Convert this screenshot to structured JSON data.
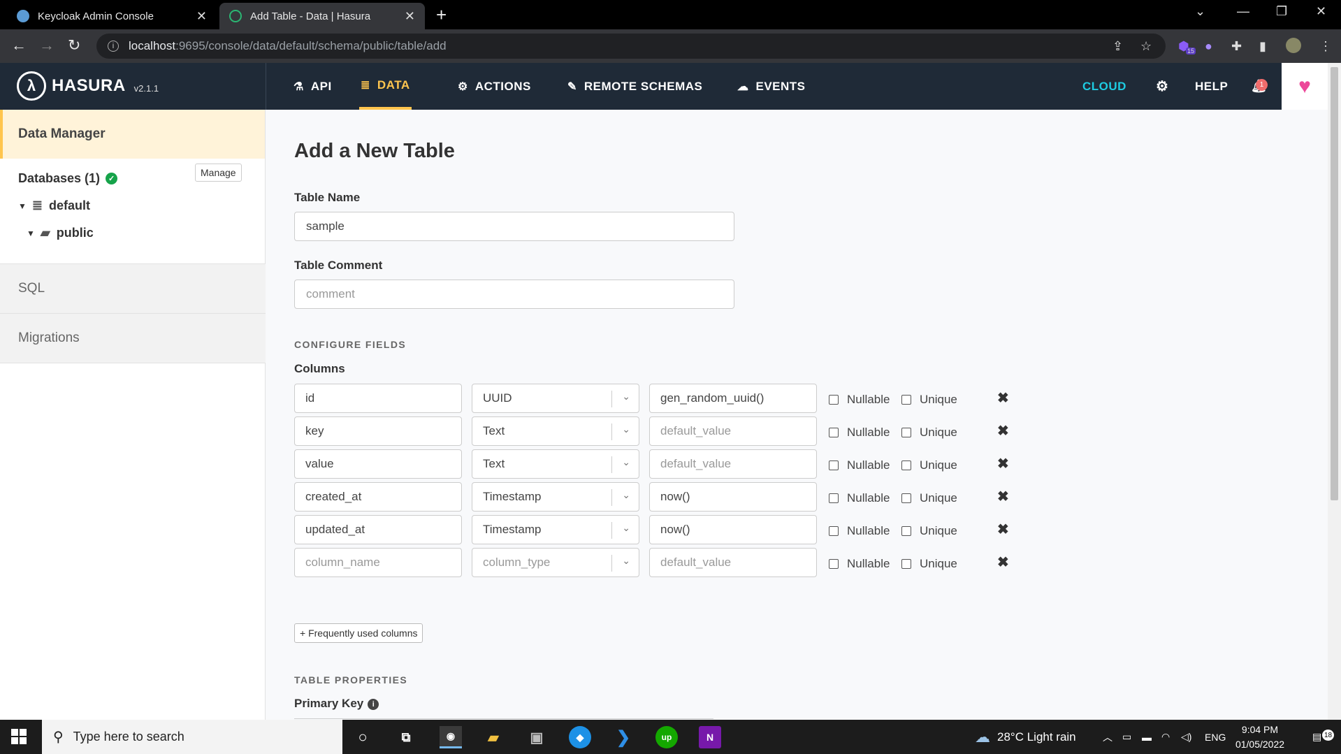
{
  "browser": {
    "tabs": [
      {
        "title": "Keycloak Admin Console",
        "active": false
      },
      {
        "title": "Add Table - Data | Hasura",
        "active": true
      }
    ],
    "url_host": "localhost",
    "url_rest": ":9695/console/data/default/schema/public/table/add",
    "extension_badge": "15"
  },
  "header": {
    "logo_text": "HASURA",
    "version": "v2.1.1",
    "nav": [
      {
        "label": "API",
        "icon": "flask-icon",
        "active": false
      },
      {
        "label": "DATA",
        "icon": "database-icon",
        "active": true
      },
      {
        "label": "ACTIONS",
        "icon": "gears-icon",
        "active": false
      },
      {
        "label": "REMOTE SCHEMAS",
        "icon": "plug-icon",
        "active": false
      },
      {
        "label": "EVENTS",
        "icon": "cloud-icon",
        "active": false
      }
    ],
    "cloud_label": "CLOUD",
    "help_label": "HELP",
    "notification_count": "1"
  },
  "sidebar": {
    "title": "Data Manager",
    "databases_label": "Databases (1)",
    "manage_label": "Manage",
    "tree": [
      {
        "label": "default",
        "icon": "database-icon"
      },
      {
        "label": "public",
        "icon": "folder-open-icon"
      }
    ],
    "items": [
      {
        "label": "SQL"
      },
      {
        "label": "Migrations"
      }
    ]
  },
  "form": {
    "page_title": "Add a New Table",
    "table_name_label": "Table Name",
    "table_name_value": "sample",
    "table_comment_label": "Table Comment",
    "table_comment_placeholder": "comment",
    "configure_fields_label": "CONFIGURE FIELDS",
    "columns_label": "Columns",
    "columns": [
      {
        "name": "id",
        "type": "UUID",
        "default": "gen_random_uuid()",
        "name_ph": false,
        "type_ph": false,
        "default_ph": false
      },
      {
        "name": "key",
        "type": "Text",
        "default": "default_value",
        "name_ph": false,
        "type_ph": false,
        "default_ph": true
      },
      {
        "name": "value",
        "type": "Text",
        "default": "default_value",
        "name_ph": false,
        "type_ph": false,
        "default_ph": true
      },
      {
        "name": "created_at",
        "type": "Timestamp",
        "default": "now()",
        "name_ph": false,
        "type_ph": false,
        "default_ph": false
      },
      {
        "name": "updated_at",
        "type": "Timestamp",
        "default": "now()",
        "name_ph": false,
        "type_ph": false,
        "default_ph": false
      },
      {
        "name": "column_name",
        "type": "column_type",
        "default": "default_value",
        "name_ph": true,
        "type_ph": true,
        "default_ph": true
      }
    ],
    "nullable_label": "Nullable",
    "unique_label": "Unique",
    "frequent_columns_label": "+ Frequently used columns",
    "table_properties_label": "TABLE PROPERTIES",
    "primary_key_label": "Primary Key"
  },
  "taskbar": {
    "search_placeholder": "Type here to search",
    "weather": "28°C  Light rain",
    "language": "ENG",
    "time": "9:04 PM",
    "date": "01/05/2022",
    "notifications": "18"
  },
  "colors": {
    "header_bg": "#1f2a37",
    "accent_yellow": "#ffc54e",
    "cloud_cyan": "#1ecbe1",
    "heart_pink": "#ec4899"
  }
}
